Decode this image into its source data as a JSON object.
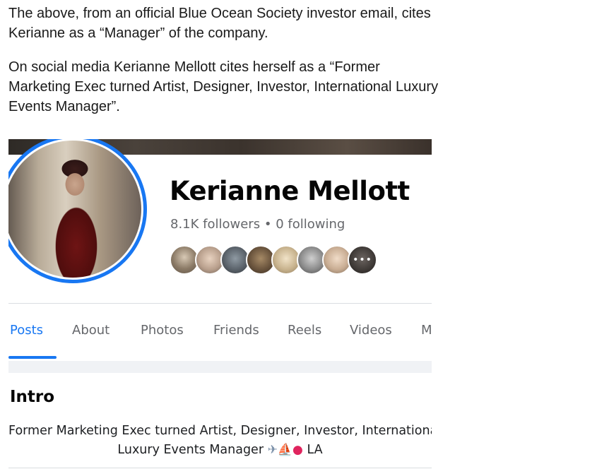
{
  "article": {
    "para1": "The above, from an official Blue Ocean Society investor email, cites Kerianne as a “Manager” of the company.",
    "para2": "On social media Kerianne Mellott cites herself as a “Former Marketing Exec turned Artist, Designer, Investor, International Luxury Events Manager”."
  },
  "profile": {
    "name": "Kerianne Mellott",
    "followers": "8.1K followers",
    "separator": "•",
    "following": "0 following",
    "more_friends": "•••",
    "tabs": [
      "Posts",
      "About",
      "Photos",
      "Friends",
      "Reels",
      "Videos",
      "M"
    ],
    "active_tab": "Posts",
    "intro_title": "Intro",
    "bio_line1": "Former Marketing Exec turned Artist, Designer, Investor, International",
    "bio_line2": "Luxury Events Manager",
    "bio_location": "LA",
    "bio_emojis": [
      "airplane-icon",
      "yacht-icon",
      "location-pin-icon"
    ]
  },
  "colors": {
    "accent": "#1877f2",
    "secondary_text": "#65676b",
    "band": "#f0f2f5"
  }
}
